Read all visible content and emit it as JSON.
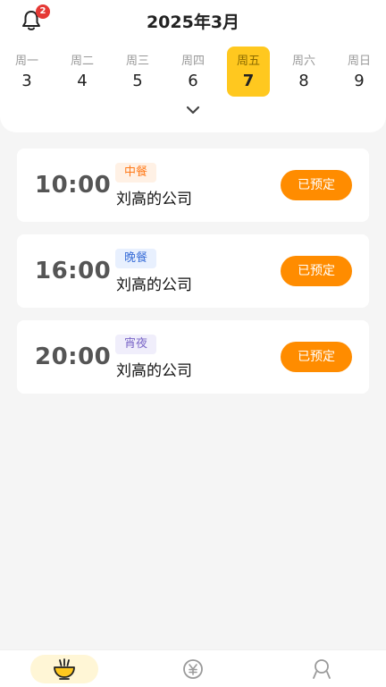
{
  "header": {
    "title": "2025年3月",
    "notification_count": "2"
  },
  "week": [
    {
      "weekday": "周一",
      "date": "3",
      "selected": false
    },
    {
      "weekday": "周二",
      "date": "4",
      "selected": false
    },
    {
      "weekday": "周三",
      "date": "5",
      "selected": false
    },
    {
      "weekday": "周四",
      "date": "6",
      "selected": false
    },
    {
      "weekday": "周五",
      "date": "7",
      "selected": true
    },
    {
      "weekday": "周六",
      "date": "8",
      "selected": false
    },
    {
      "weekday": "周日",
      "date": "9",
      "selected": false
    }
  ],
  "meals": [
    {
      "time": "10:00",
      "tag": "中餐",
      "company": "刘高的公司",
      "action": "已预定"
    },
    {
      "time": "16:00",
      "tag": "晚餐",
      "company": "刘高的公司",
      "action": "已预定"
    },
    {
      "time": "20:00",
      "tag": "宵夜",
      "company": "刘高的公司",
      "action": "已预定"
    }
  ],
  "tabs": {
    "active": 0,
    "icons": [
      "meal-bowl-icon",
      "yen-coin-icon",
      "user-profile-icon"
    ]
  },
  "colors": {
    "accent": "#ffc81f",
    "button": "#ff8c00",
    "badge": "#e53935"
  }
}
